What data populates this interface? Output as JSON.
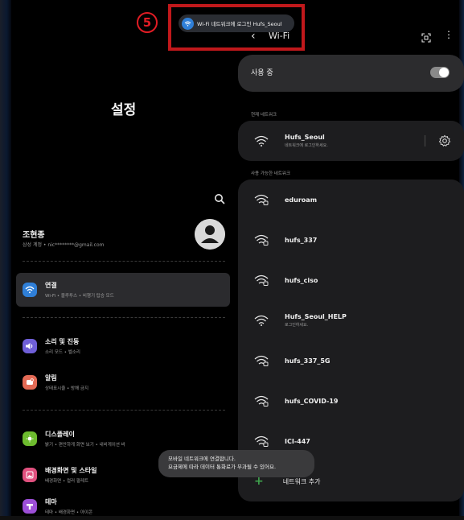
{
  "annotation": {
    "number": "5"
  },
  "toast": {
    "text": "Wi-Fi 네트워크에 로그인  Hufs_Seoul"
  },
  "settings": {
    "title": "설정",
    "profile": {
      "name": "조현종",
      "sub": "삼성 계정 • nic********@gmail.com"
    },
    "menu": [
      {
        "title": "연결",
        "sub": "Wi-Fi • 블루투스 • 비행기 탑승 모드",
        "color": "#2f7fd8",
        "icon": "wifi-icon",
        "active": true
      },
      {
        "title": "소리 및 진동",
        "sub": "소리 모드 • 벨소리",
        "color": "#6f5fd8",
        "icon": "volume-icon"
      },
      {
        "title": "알림",
        "sub": "상태표시줄 • 방해 금지",
        "color": "#e36a55",
        "icon": "bell-icon"
      },
      {
        "title": "디스플레이",
        "sub": "밝기 • 편안하게 화면 보기 • 내비게이션 바",
        "color": "#6dbb2e",
        "icon": "sun-icon"
      },
      {
        "title": "배경화면 및 스타일",
        "sub": "배경화면 • 컬러 팔레트",
        "color": "#e0507e",
        "icon": "image-icon"
      },
      {
        "title": "테마",
        "sub": "테마 • 배경화면 • 아이콘",
        "color": "#9d4fd8",
        "icon": "theme-icon"
      }
    ]
  },
  "wifi": {
    "title": "Wi-Fi",
    "using_label": "사용 중",
    "current_label": "현재 네트워크",
    "available_label": "사용 가능한 네트워크",
    "current": {
      "name": "Hufs_Seoul",
      "sub": "네트워크에 로그인하세요."
    },
    "available": [
      {
        "name": "eduroam",
        "locked": true
      },
      {
        "name": "hufs_337",
        "locked": true
      },
      {
        "name": "hufs_ciso",
        "locked": true
      },
      {
        "name": "Hufs_Seoul_HELP",
        "sub": "로그인하세요.",
        "locked": false
      },
      {
        "name": "hufs_337_5G",
        "locked": true
      },
      {
        "name": "hufs_COVID-19",
        "locked": true
      },
      {
        "name": "ICI-447",
        "locked": true
      }
    ],
    "add_network": "네트워크 추가"
  },
  "snackbar": {
    "line1": "모바일 네트워크에 연결합니다.",
    "line2": "요금제에 따라 데이터 통화료가 부과될 수 있어요."
  }
}
